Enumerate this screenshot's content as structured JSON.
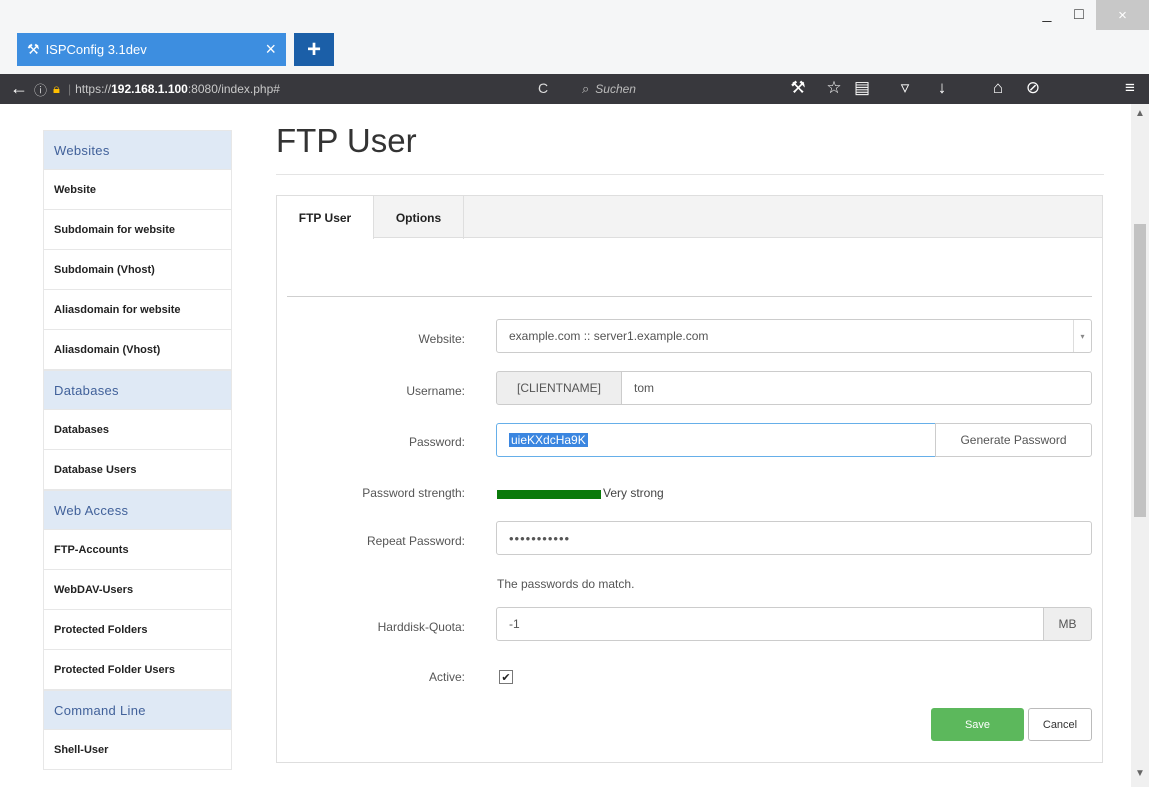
{
  "browser": {
    "tab_title": "ISPConfig 3.1dev",
    "tab_close": "×",
    "new_tab": "+",
    "window_controls": {
      "minimize": "_",
      "maximize": "□",
      "close": "×"
    },
    "url_prefix": "https://",
    "url_host": "192.168.1.100",
    "url_rest": ":8080/index.php#",
    "reload": "C",
    "search_placeholder": "Suchen",
    "icons": [
      "back-icon",
      "info-icon",
      "lock-warning-icon",
      "reload-icon",
      "search-icon",
      "wrench-icon",
      "star-icon",
      "reader-icon",
      "pocket-icon",
      "download-icon",
      "home-icon",
      "blocked-icon",
      "menu-icon"
    ]
  },
  "sidebar": {
    "sections": [
      {
        "title": "Websites",
        "items": [
          "Website",
          "Subdomain for website",
          "Subdomain (Vhost)",
          "Aliasdomain for website",
          "Aliasdomain (Vhost)"
        ]
      },
      {
        "title": "Databases",
        "items": [
          "Databases",
          "Database Users"
        ]
      },
      {
        "title": "Web Access",
        "items": [
          "FTP-Accounts",
          "WebDAV-Users",
          "Protected Folders",
          "Protected Folder Users"
        ]
      },
      {
        "title": "Command Line",
        "items": [
          "Shell-User"
        ]
      }
    ]
  },
  "main": {
    "title": "FTP User",
    "tabs": [
      {
        "label": "FTP User",
        "active": true
      },
      {
        "label": "Options",
        "active": false
      }
    ],
    "form": {
      "website": {
        "label": "Website:",
        "value": "example.com :: server1.example.com"
      },
      "username": {
        "label": "Username:",
        "prefix": "[CLIENTNAME]",
        "value": "tom"
      },
      "password": {
        "label": "Password:",
        "value": "uieKXdcHa9K",
        "generate_button": "Generate Password"
      },
      "strength": {
        "label": "Password strength:",
        "value": "Very strong",
        "color": "#0a7a0a"
      },
      "repeat": {
        "label": "Repeat Password:",
        "value": "•••••••••••"
      },
      "match_message": "The passwords do match.",
      "quota": {
        "label": "Harddisk-Quota:",
        "value": "-1",
        "unit": "MB"
      },
      "active": {
        "label": "Active:",
        "checked": true,
        "check_glyph": "✔"
      },
      "save_button": "Save",
      "cancel_button": "Cancel"
    }
  },
  "colors": {
    "save": "#5cb85c",
    "tab_active": "#3d8ee0",
    "sidebar_header": "#dfe9f5"
  }
}
